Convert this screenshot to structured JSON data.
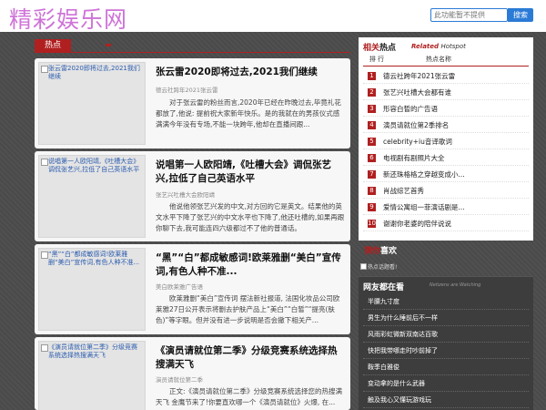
{
  "header": {
    "logo": "精彩娱乐网",
    "search_placeholder": "此功能暂不提供",
    "search_button": "搜索"
  },
  "hot": {
    "tab_label": "热点"
  },
  "articles": [
    {
      "thumb_alt": "张云雷2020即将过去,2021我们继续",
      "title": "张云雷2020即将过去,2021我们继续",
      "meta": "德云社跨年2021张云雷",
      "summary": "对于张云雷的粉丝而言,2020年已经在昨晚过去,毕竟礼花都放了,他说: 提前祝大家新年快乐。是的我就在的男孩仪式感满满今年没有专场,不能一块跨年,他却在直播间跟..."
    },
    {
      "thumb_alt": "说唱第一人欧阳靖,《吐槽大会》调侃张艺兴,拉低了自己英语水平",
      "title": "说唱第一人欧阳靖,《吐槽大会》调侃张艺兴,拉低了自己英语水平",
      "meta": "张艺兴吐槽大会欧阳靖",
      "summary": "他说他领张艺兴发的中文,对方回的它是英文。结果他的英文水平下降了张艺兴的中文水平也下降了,他还吐槽的,如果再跟你聊下去,我可能连四六级都过不了他的普通话。"
    },
    {
      "thumb_alt": "“黑”“白”都成敏感词!欧莱雅删“美白”宣传词,有色人种不准...",
      "title": "“黑”“白”都成敏感词!欧莱雅删“美白”宣传词,有色人种不准...",
      "meta": "美白欧莱雅广告语",
      "summary": "欧莱雅删“美白”宣传词 摆法新社报道, 法国化妆品公司欧莱雅27日公开表示将删去护肤产品上“美白”“白皙”“提亮(肤色)”等字眼。但并没有进一步说明是否会撤下相关产..."
    },
    {
      "thumb_alt": "《演员请就位第二季》分级竞赛系统选择热搜满天飞",
      "title": "《演员请就位第二季》分级竞赛系统选择热搜满天飞",
      "meta": "演员请就位第二季",
      "summary": "正文:《演员请就位第二季》分级竞赛系统选择您的热搜满天飞 金鹰节来了!你要直欢哪一个《演员请就位》火爆, 在..."
    }
  ],
  "related": {
    "title_red": "相关",
    "title_rest": "热点",
    "sub_red": "Related",
    "sub_rest": "Hotspot",
    "col_rank": "排 行",
    "col_keyword": "热点名称",
    "items": [
      {
        "rank": "1",
        "text": "德云社跨年2021张云雷"
      },
      {
        "rank": "2",
        "text": "张艺兴吐槽大会都有谁"
      },
      {
        "rank": "3",
        "text": "形容白皙的广告语"
      },
      {
        "rank": "4",
        "text": "演员请就位第2季排名"
      },
      {
        "rank": "5",
        "text": "celebrity+iu音译歌词"
      },
      {
        "rank": "6",
        "text": "电视剧有剧照片大全"
      },
      {
        "rank": "7",
        "text": "新还珠格格之穿越变成小..."
      },
      {
        "rank": "8",
        "text": "肖战综艺首秀"
      },
      {
        "rank": "9",
        "text": "爱情公寓组一菲演话剧是..."
      },
      {
        "rank": "10",
        "text": "谢谢你老婆的陪伴说说"
      }
    ]
  },
  "guess": {
    "title_red": "猜你",
    "title_rest": "喜欢",
    "img_alt": "热点话题看!"
  },
  "netizen": {
    "title": "网友都在看",
    "sub": "Netizens are Watching",
    "items": [
      "半腰九寸度",
      "男生为什么睡前后不一样",
      "风雨彩虹微新双南达百歌",
      "快把我带哪走时吵前掉了",
      "鞍季白雅俊",
      "变动拿的是什么武器",
      "触及我心又懂玩游戏玩",
      "男朋友又看又高冷"
    ]
  }
}
